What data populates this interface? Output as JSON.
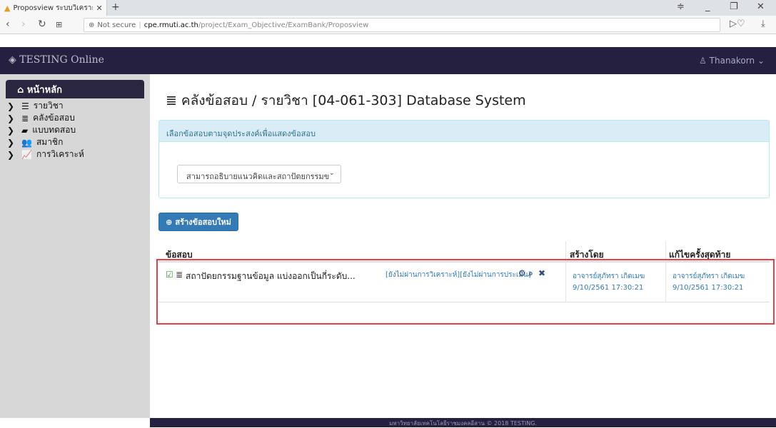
{
  "browser": {
    "tab_title": "Proposview ระบบวิเคราะห์แ",
    "tab_close": "✕",
    "new_tab": "+",
    "url_security": "Not secure",
    "url_host": "cpe.rmuti.ac.th",
    "url_path": "/project/Exam_Objective/ExamBank/Proposview"
  },
  "header": {
    "brand": "TESTING Online",
    "user": "Thanakorn"
  },
  "sidebar": {
    "home": "หน้าหลัก",
    "items": [
      {
        "icon": "list-icon",
        "glyph": "☰",
        "label": "รายวิชา"
      },
      {
        "icon": "database-icon",
        "glyph": "≣",
        "label": "คลังข้อสอบ"
      },
      {
        "icon": "book-icon",
        "glyph": "▰",
        "label": "แบบทดสอบ"
      },
      {
        "icon": "users-icon",
        "glyph": "👥",
        "label": "สมาชิก"
      },
      {
        "icon": "chart-icon",
        "glyph": "📈",
        "label": "การวิเคราะห์"
      }
    ]
  },
  "page": {
    "title": "คลังข้อสอบ / รายวิชา [04-061-303] Database System"
  },
  "filter_panel": {
    "heading": "เลือกข้อสอบตามจุดประสงค์เพื่อแสดงข้อสอบ",
    "selected": "สามารถอธิบายแนวคิดและสถาปัตยกรรมข"
  },
  "new_button": "สร้างข้อสอบใหม่",
  "table": {
    "headers": {
      "question": "ข้อสอบ",
      "created_by": "สร้างโดย",
      "last_edit": "แก้ไขครั้งสุดท้าย"
    },
    "rows": [
      {
        "question": "สถาปัตยกรรมฐานข้อมูล แบ่งออกเป็นกี่ระดับ...",
        "status": "[ยังไม่ผ่านการวิเคราะห์][ยังไม่ผ่านการประเมิน]",
        "created_by": "อาจารย์สุภัทรา เกิดเมฆ",
        "created_at": "9/10/2561 17:30:21",
        "edited_by": "อาจารย์สุภัทรา เกิดเมฆ",
        "edited_at": "9/10/2561 17:30:21"
      }
    ]
  },
  "footer": "มหาวิทยาลัยเทคโนโลยีราชมงคลอีสาน © 2018 TESTING."
}
